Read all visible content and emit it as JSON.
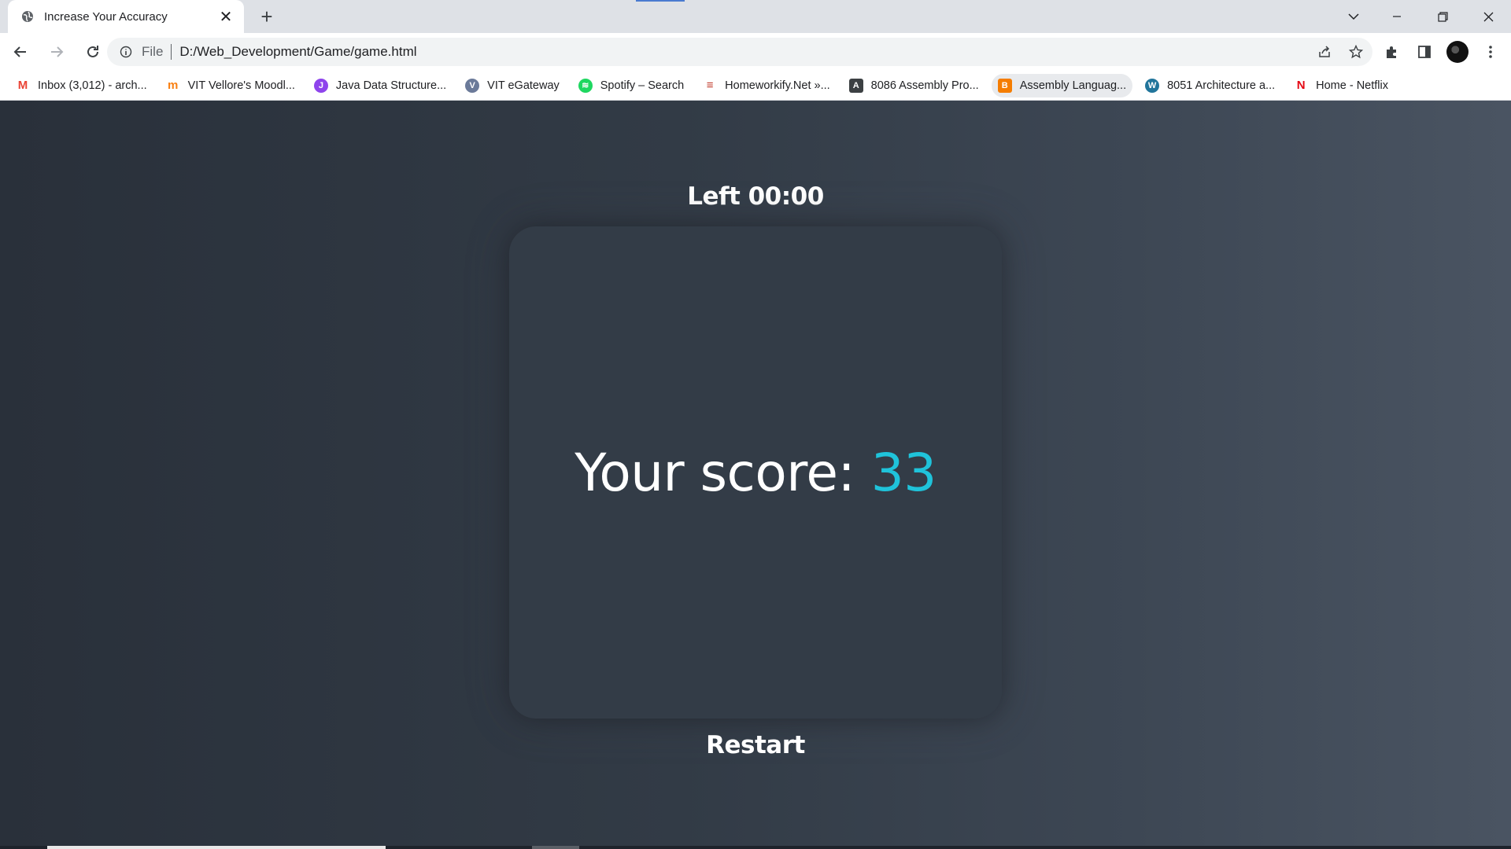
{
  "browser": {
    "tab_title": "Increase Your Accuracy",
    "url_scheme": "File",
    "url": "D:/Web_Development/Game/game.html"
  },
  "bookmarks": [
    {
      "label": "Inbox (3,012) - arch...",
      "icon": "gmail-icon",
      "color": "#ea4335"
    },
    {
      "label": "VIT Vellore's Moodl...",
      "icon": "moodle-icon",
      "color": "#f98012"
    },
    {
      "label": "Java Data Structure...",
      "icon": "java-icon",
      "color": "#8e44ec"
    },
    {
      "label": "VIT eGateway",
      "icon": "vit-icon",
      "color": "#6b7a99"
    },
    {
      "label": "Spotify – Search",
      "icon": "spotify-icon",
      "color": "#1ed760"
    },
    {
      "label": "Homeworkify.Net »...",
      "icon": "books-icon",
      "color": "#c0392b"
    },
    {
      "label": "8086 Assembly Pro...",
      "icon": "letter-a-icon",
      "color": "#3c4043"
    },
    {
      "label": "Assembly Languag...",
      "icon": "blogger-icon",
      "color": "#f57d00"
    },
    {
      "label": "8051 Architecture a...",
      "icon": "wordpress-icon",
      "color": "#21759b"
    },
    {
      "label": "Home - Netflix",
      "icon": "netflix-icon",
      "color": "#e50914"
    }
  ],
  "game": {
    "timer_text": "Left 00:00",
    "score_label": "Your score: ",
    "score_value": "33",
    "restart_label": "Restart",
    "accent_color": "#1fc3da"
  }
}
